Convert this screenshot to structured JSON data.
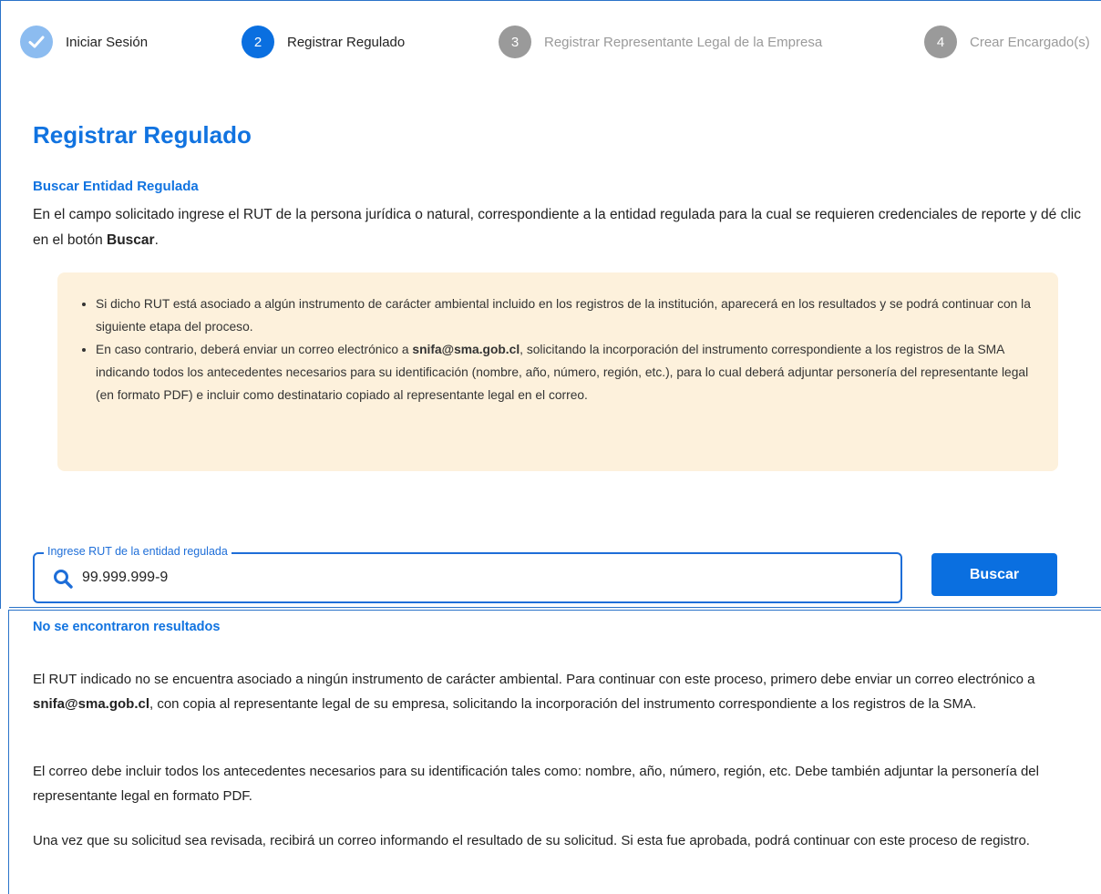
{
  "stepper": {
    "steps": [
      {
        "number": "",
        "label": "Iniciar Sesión",
        "state": "done"
      },
      {
        "number": "2",
        "label": "Registrar Regulado",
        "state": "active"
      },
      {
        "number": "3",
        "label": "Registrar Representante Legal de la Empresa",
        "state": "inactive"
      },
      {
        "number": "4",
        "label": "Crear Encargado(s)",
        "state": "inactive"
      }
    ]
  },
  "page": {
    "title": "Registrar Regulado",
    "subtitle": "Buscar Entidad Regulada",
    "intro_text": "En el campo solicitado ingrese el RUT de la persona jurídica o natural, correspondiente a la entidad regulada para la cual se requieren credenciales de reporte y dé clic en el botón ",
    "intro_bold": "Buscar",
    "intro_end": "."
  },
  "notice": {
    "item1": "Si dicho RUT está asociado a algún instrumento de carácter ambiental incluido en los registros de la institución, aparecerá en los resultados y se podrá continuar con la siguiente etapa del proceso.",
    "item2_pre": "En caso contrario, deberá enviar un correo electrónico a ",
    "item2_email": "snifa@sma.gob.cl",
    "item2_post": ", solicitando la incorporación del instrumento correspondiente a los registros de la SMA indicando todos los antecedentes necesarios para su identificación (nombre, año, número, región, etc.), para lo cual deberá adjuntar personería del representante legal (en formato PDF) e incluir como destinatario copiado al representante legal en el correo."
  },
  "search": {
    "legend": "Ingrese RUT de la entidad regulada",
    "value": "99.999.999-9",
    "button_label": "Buscar",
    "icon": "search-icon"
  },
  "results": {
    "title": "No se encontraron resultados",
    "p1_pre": "El RUT indicado no se encuentra asociado a ningún instrumento de carácter ambiental. Para continuar con este proceso, primero debe enviar un correo electrónico a ",
    "p1_email": "snifa@sma.gob.cl",
    "p1_post": ", con copia al representante legal de su empresa, solicitando la incorporación del instrumento correspondiente a los registros de la SMA.",
    "p2": "El correo debe incluir todos los antecedentes necesarios para su identificación tales como: nombre, año, número, región, etc. Debe también adjuntar la personería del representante legal en formato PDF.",
    "p3": "Una vez que su solicitud sea revisada, recibirá un correo informando el resultado de su solicitud. Si esta fue aprobada, podrá continuar con este proceso de registro."
  },
  "colors": {
    "primary": "#0a6fe0",
    "done_step": "#8cbcf0",
    "inactive_step": "#9a9a9a",
    "notice_bg": "#fdf1dc"
  }
}
